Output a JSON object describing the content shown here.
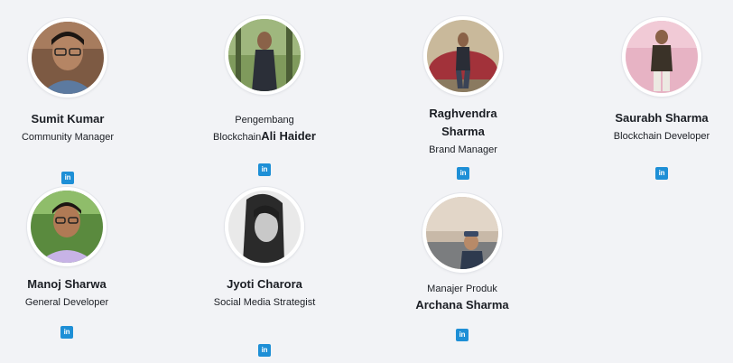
{
  "team": [
    {
      "name": "Sumit Kumar",
      "role": "Community Manager",
      "social_icon": "linkedin-icon"
    },
    {
      "prefix_line1": "Pengembang",
      "prefix_line2": "Blockchain",
      "name": "Ali Haider",
      "social_icon": "linkedin-icon"
    },
    {
      "name_line1": "Raghvendra",
      "name_line2": "Sharma",
      "role": "Brand Manager",
      "social_icon": "linkedin-icon"
    },
    {
      "name": "Saurabh Sharma",
      "role": "Blockchain Developer",
      "social_icon": "linkedin-icon"
    },
    {
      "name": "Manoj Sharwa",
      "role": "General Developer",
      "social_icon": "linkedin-icon"
    },
    {
      "name": "Jyoti Charora",
      "role": "Social Media Strategist",
      "social_icon": "linkedin-icon"
    },
    {
      "prefix": "Manajer Produk",
      "name": "Archana Sharma",
      "social_icon": "linkedin-icon"
    }
  ],
  "linkedin_label": "in",
  "colors": {
    "background": "#f2f3f6",
    "linkedin": "#1e8fd6",
    "text": "#1b1e24"
  }
}
